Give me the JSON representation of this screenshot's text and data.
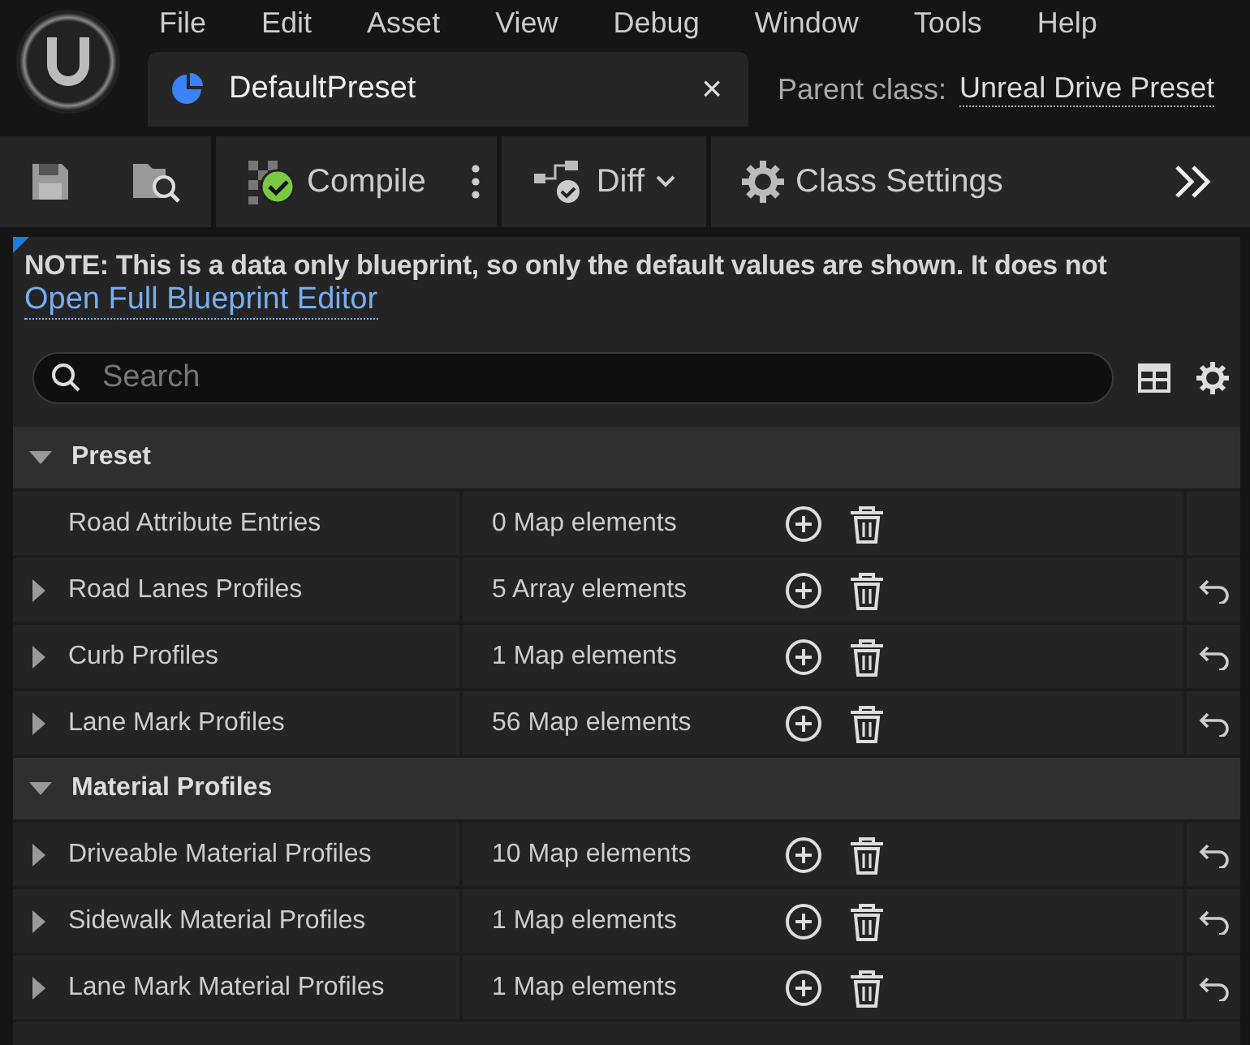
{
  "menu": [
    "File",
    "Edit",
    "Asset",
    "View",
    "Debug",
    "Window",
    "Tools",
    "Help"
  ],
  "tab": {
    "title": "DefaultPreset",
    "close": "×"
  },
  "parent_class": {
    "label": "Parent class:",
    "value": "Unreal Drive Preset"
  },
  "toolbar": [
    {
      "kind": "save"
    },
    {
      "kind": "browse"
    },
    {
      "kind": "compile",
      "label": "Compile"
    },
    {
      "kind": "more"
    },
    {
      "kind": "diff",
      "label": "Diff"
    },
    {
      "kind": "settings",
      "label": "Class Settings"
    },
    {
      "kind": "overflow"
    }
  ],
  "note": {
    "text": "NOTE: This is a data only blueprint, so only the default values are shown.  It does not",
    "link": "Open Full Blueprint Editor"
  },
  "search": {
    "placeholder": "Search"
  },
  "categories": [
    {
      "name": "Preset",
      "expanded": true,
      "rows": [
        {
          "name": "Road Attribute Entries",
          "value": "0 Map elements",
          "expandable": false,
          "resettable": false
        },
        {
          "name": "Road Lanes Profiles",
          "value": "5 Array elements",
          "expandable": true,
          "resettable": true
        },
        {
          "name": "Curb Profiles",
          "value": "1 Map elements",
          "expandable": true,
          "resettable": true
        },
        {
          "name": "Lane Mark Profiles",
          "value": "56 Map elements",
          "expandable": true,
          "resettable": true
        }
      ]
    },
    {
      "name": "Material Profiles",
      "expanded": true,
      "rows": [
        {
          "name": "Driveable Material Profiles",
          "value": "10 Map elements",
          "expandable": true,
          "resettable": true
        },
        {
          "name": "Sidewalk Material Profiles",
          "value": "1 Map elements",
          "expandable": true,
          "resettable": true
        },
        {
          "name": "Lane Mark Material Profiles",
          "value": "1 Map elements",
          "expandable": true,
          "resettable": true
        }
      ]
    }
  ]
}
